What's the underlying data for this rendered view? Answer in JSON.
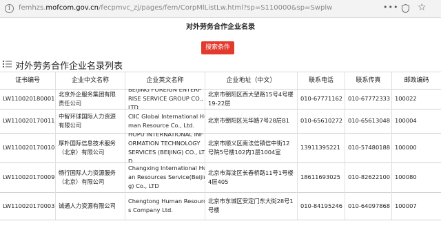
{
  "browser": {
    "url_prefix": "femhzs.",
    "url_domain": "mofcom.gov.cn",
    "url_suffix": "/fecpmvc_zj/pages/fem/CorpMlListLw.html?sp=S110000&sp=Swplw"
  },
  "page": {
    "title": "对外劳务合作企业名录",
    "search_button": "搜索条件",
    "list_heading": "对外劳务合作企业名录列表"
  },
  "table": {
    "headers": [
      "证书编号",
      "企业中文名称",
      "企业英文名称",
      "企业地址（中文）",
      "联系电话",
      "联系传真",
      "邮政编码"
    ],
    "rows": [
      {
        "cert": "LW110020180001",
        "cn_name": [
          "北京外企服务集团有限",
          "责任公司"
        ],
        "en_name": [
          "BEIJING FOREIGN ENTERP",
          "RISE SERVICE GROUP CO.,",
          "LTD"
        ],
        "address": [
          "北京市朝阳区西大望路15号4号楼",
          "19-22层"
        ],
        "phone": "010-67771162",
        "fax": "010-67772333",
        "zip": "100022"
      },
      {
        "cert": "LW110020170011",
        "cn_name": [
          "中智环球国际人力资源",
          "有限公司"
        ],
        "en_name": [
          "CIIC Global International Hu",
          "man Resource Co., Ltd."
        ],
        "address": [
          "北京市朝阳区光华路7号28层B1"
        ],
        "phone": "010-65610272",
        "fax": "010-65613048",
        "zip": "100004"
      },
      {
        "cert": "LW110020170010",
        "cn_name": [
          "厚朴国际信息技术服务",
          "（北京）有限公司"
        ],
        "en_name": [
          "HOPU INTERNATIONAL INF",
          "ORMATION TECHNOLOGY",
          "SERVICES (BEIJING) CO., LT",
          "D"
        ],
        "address": [
          "北京市顺义区南法信镇信中街12",
          "号院5号楼102内1层1004室"
        ],
        "phone": "13911395221",
        "fax": "010-57480188",
        "zip": "100000"
      },
      {
        "cert": "LW110020170009",
        "cn_name": [
          "畅行国际人力资源服务",
          "（北京）有限公司"
        ],
        "en_name": [
          "Changxing International Hum",
          "an Resources Service(Beijin",
          "g) Co., LTD"
        ],
        "address": [
          "北京市海淀区长春桥路11号1号楼",
          "4层405"
        ],
        "phone": "18611693025",
        "fax": "010-82622100",
        "zip": "100080"
      },
      {
        "cert": "LW110020170003",
        "cn_name": [
          "诚通人力资源有限公司"
        ],
        "en_name": [
          "Chengtong Human Resource",
          "s Company Ltd."
        ],
        "address": [
          "北京市东城区安定门东大街28号1",
          "号楼"
        ],
        "phone": "010-84195246",
        "fax": "010-64097868",
        "zip": "100007"
      }
    ]
  }
}
